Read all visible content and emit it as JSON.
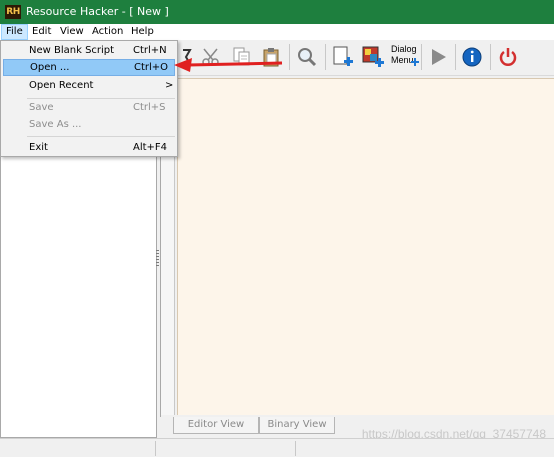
{
  "window": {
    "title": "Resource Hacker - [ New ]",
    "icon_text": "RH",
    "accent_color": "#1e7f3e"
  },
  "menu": [
    {
      "label": "File"
    },
    {
      "label": "Edit"
    },
    {
      "label": "View"
    },
    {
      "label": "Action"
    },
    {
      "label": "Help"
    }
  ],
  "file_menu": {
    "items": [
      {
        "label": "New Blank Script",
        "shortcut": "Ctrl+N",
        "state": "normal"
      },
      {
        "label": "Open ...",
        "shortcut": "Ctrl+O",
        "state": "highlighted"
      },
      {
        "label": "Open Recent",
        "shortcut": "",
        "submenu_arrow": ">",
        "state": "normal"
      },
      {
        "label": "Save",
        "shortcut": "Ctrl+S",
        "state": "disabled"
      },
      {
        "label": "Save As ...",
        "shortcut": "",
        "state": "disabled"
      },
      {
        "label": "Exit",
        "shortcut": "Alt+F4",
        "state": "normal"
      }
    ]
  },
  "toolbar": {
    "buttons": [
      {
        "icon": "compile-icon"
      },
      {
        "icon": "cut-icon"
      },
      {
        "icon": "copy-icon"
      },
      {
        "icon": "paste-icon"
      },
      {
        "icon": "find-icon"
      },
      {
        "icon": "add-resource-icon"
      },
      {
        "icon": "add-image-icon"
      },
      {
        "icon": "dialog-menu-icon"
      },
      {
        "icon": "run-script-icon"
      },
      {
        "icon": "about-info-icon"
      },
      {
        "icon": "exit-power-icon"
      }
    ],
    "dialog_label_line1": "Dialog",
    "dialog_label_line2": "Menu"
  },
  "tabs": [
    {
      "label": "Editor View"
    },
    {
      "label": "Binary View"
    }
  ],
  "watermark": "https://blog.csdn.net/qq_37457748"
}
